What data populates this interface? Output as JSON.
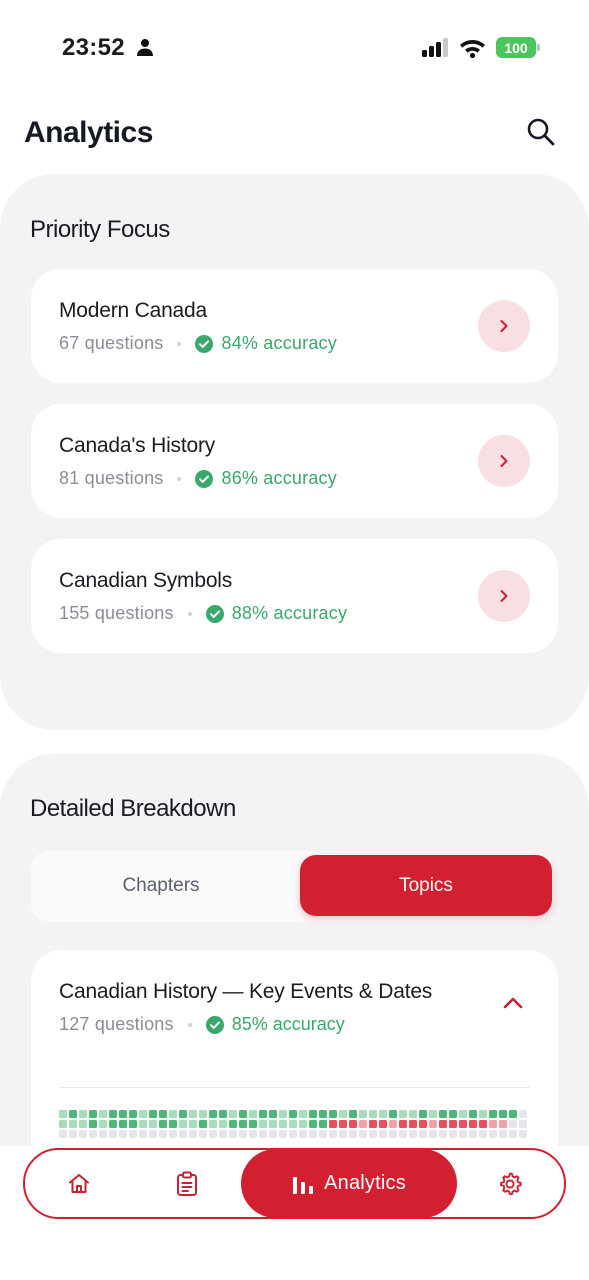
{
  "status_bar": {
    "time": "23:52",
    "battery": "100",
    "icons": [
      "person-icon",
      "signal-icon",
      "wifi-icon",
      "battery-icon"
    ]
  },
  "header": {
    "title": "Analytics",
    "search_icon": "search-icon"
  },
  "priority_focus": {
    "title": "Priority Focus",
    "items": [
      {
        "title": "Modern Canada",
        "questions": "67 questions",
        "accuracy": "84% accuracy"
      },
      {
        "title": "Canada's History",
        "questions": "81 questions",
        "accuracy": "86% accuracy"
      },
      {
        "title": "Canadian Symbols",
        "questions": "155 questions",
        "accuracy": "88% accuracy"
      }
    ]
  },
  "breakdown": {
    "title": "Detailed Breakdown",
    "tabs": [
      {
        "label": "Chapters",
        "active": false
      },
      {
        "label": "Topics",
        "active": true
      }
    ],
    "topic": {
      "title": "Canadian History — Key Events & Dates",
      "questions": "127 questions",
      "accuracy": "85% accuracy",
      "expanded": true
    }
  },
  "nav": {
    "items": [
      {
        "id": "home",
        "icon": "home-icon"
      },
      {
        "id": "tests",
        "icon": "clipboard-icon"
      },
      {
        "id": "analytics",
        "icon": "bar-chart-icon",
        "label": "Analytics",
        "active": true
      },
      {
        "id": "settings",
        "icon": "gear-icon"
      }
    ]
  },
  "colors": {
    "accent": "#d32030",
    "accent_soft": "#f7dfe2",
    "success": "#3aa86a",
    "panel_bg": "#f3f3f5",
    "grid_correct": "#4fb77a",
    "grid_correct_light": "#a8dcbc",
    "grid_incorrect": "#e5505c",
    "grid_incorrect_light": "#f2a1a7",
    "grid_unanswered": "#e4e6ec"
  }
}
